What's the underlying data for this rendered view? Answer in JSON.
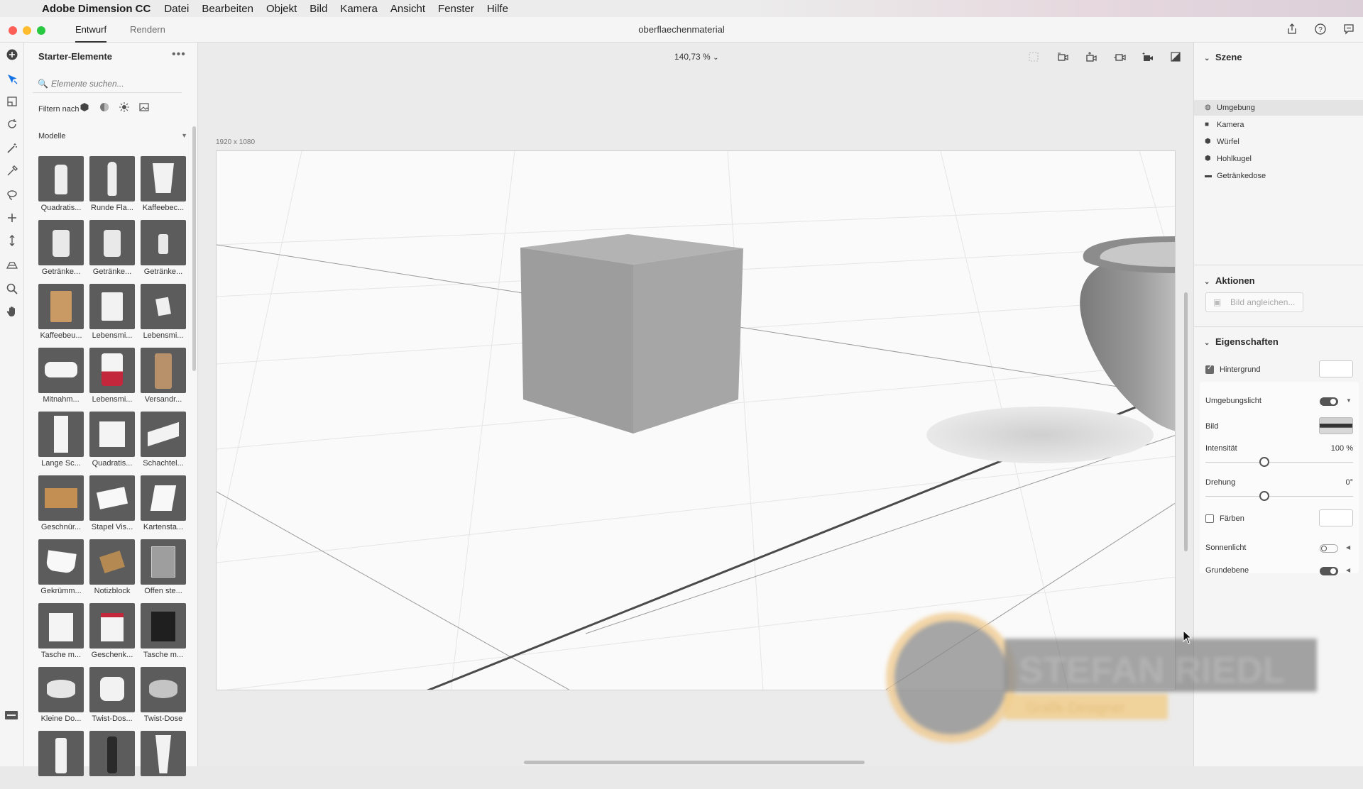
{
  "menubar": {
    "app_name": "Adobe Dimension CC",
    "items": [
      "Datei",
      "Bearbeiten",
      "Objekt",
      "Bild",
      "Kamera",
      "Ansicht",
      "Fenster",
      "Hilfe"
    ]
  },
  "titlebar": {
    "tabs": [
      "Entwurf",
      "Rendern"
    ],
    "active_tab": "Entwurf",
    "document_title": "oberflaechenmaterial"
  },
  "tools": [
    "add-icon",
    "select-icon",
    "move-icon",
    "rotate-icon",
    "magic-wand-icon",
    "eyedropper-icon",
    "lasso-icon",
    "plus-icon",
    "dolly-icon",
    "horizon-icon",
    "zoom-icon",
    "hand-icon"
  ],
  "left_panel": {
    "title": "Starter-Elemente",
    "search_placeholder": "Elemente suchen...",
    "filter_label": "Filtern nach",
    "section_label": "Modelle",
    "models": [
      {
        "label": "Quadratis...",
        "shape": "bottle"
      },
      {
        "label": "Runde Fla...",
        "shape": "slim-bottle"
      },
      {
        "label": "Kaffeebec...",
        "shape": "cup"
      },
      {
        "label": "Getränke...",
        "shape": "can"
      },
      {
        "label": "Getränke...",
        "shape": "can"
      },
      {
        "label": "Getränke...",
        "shape": "small-can"
      },
      {
        "label": "Kaffeebeu...",
        "shape": "bag"
      },
      {
        "label": "Lebensmi...",
        "shape": "pouch"
      },
      {
        "label": "Lebensmi...",
        "shape": "sachet"
      },
      {
        "label": "Mitnahm...",
        "shape": "clamshell"
      },
      {
        "label": "Lebensmi...",
        "shape": "red-can"
      },
      {
        "label": "Versandr...",
        "shape": "tube"
      },
      {
        "label": "Lange Sc...",
        "shape": "tall-box"
      },
      {
        "label": "Quadratis...",
        "shape": "cube"
      },
      {
        "label": "Schachtel...",
        "shape": "flat-box"
      },
      {
        "label": "Geschnür...",
        "shape": "parcel"
      },
      {
        "label": "Stapel Vis...",
        "shape": "cards"
      },
      {
        "label": "Kartensta...",
        "shape": "card-stand"
      },
      {
        "label": "Gekrümm...",
        "shape": "curved-sheet"
      },
      {
        "label": "Notizblock",
        "shape": "notepad"
      },
      {
        "label": "Offen ste...",
        "shape": "open-box"
      },
      {
        "label": "Tasche m...",
        "shape": "white-bag"
      },
      {
        "label": "Geschenk...",
        "shape": "gift-bag"
      },
      {
        "label": "Tasche m...",
        "shape": "black-bag"
      },
      {
        "label": "Kleine Do...",
        "shape": "tin"
      },
      {
        "label": "Twist-Dos...",
        "shape": "jar"
      },
      {
        "label": "Twist-Dose",
        "shape": "metal-tin"
      },
      {
        "label": "",
        "shape": "pump-bottle"
      },
      {
        "label": "",
        "shape": "dark-bottle"
      },
      {
        "label": "",
        "shape": "cream-tube"
      }
    ]
  },
  "center": {
    "zoom": "140,73 %",
    "doc_size": "1920 x 1080"
  },
  "right_panel": {
    "scene_title": "Szene",
    "scene_items": [
      {
        "label": "Umgebung",
        "icon": "globe-icon",
        "selected": true
      },
      {
        "label": "Kamera",
        "icon": "camera-icon",
        "selected": false
      },
      {
        "label": "Würfel",
        "icon": "cube-icon",
        "selected": false
      },
      {
        "label": "Hohlkugel",
        "icon": "cube-icon",
        "selected": false
      },
      {
        "label": "Getränkedose",
        "icon": "folder-icon",
        "selected": false
      }
    ],
    "actions_title": "Aktionen",
    "match_image_button": "Bild angleichen...",
    "properties_title": "Eigenschaften",
    "background_label": "Hintergrund",
    "background_checked": true,
    "env_light_label": "Umgebungslicht",
    "env_light_on": true,
    "image_label": "Bild",
    "intensity_label": "Intensität",
    "intensity_value": "100 %",
    "intensity_fraction": 0.4,
    "rotation_label": "Drehung",
    "rotation_value": "0°",
    "rotation_fraction": 0.4,
    "colorize_label": "Färben",
    "colorize_checked": false,
    "sunlight_label": "Sonnenlicht",
    "sunlight_on": false,
    "groundplane_label": "Grundebene",
    "groundplane_on": true
  },
  "watermark": {
    "name": "STEFAN RIEDL",
    "subtitle": "Grafik-Designer"
  }
}
